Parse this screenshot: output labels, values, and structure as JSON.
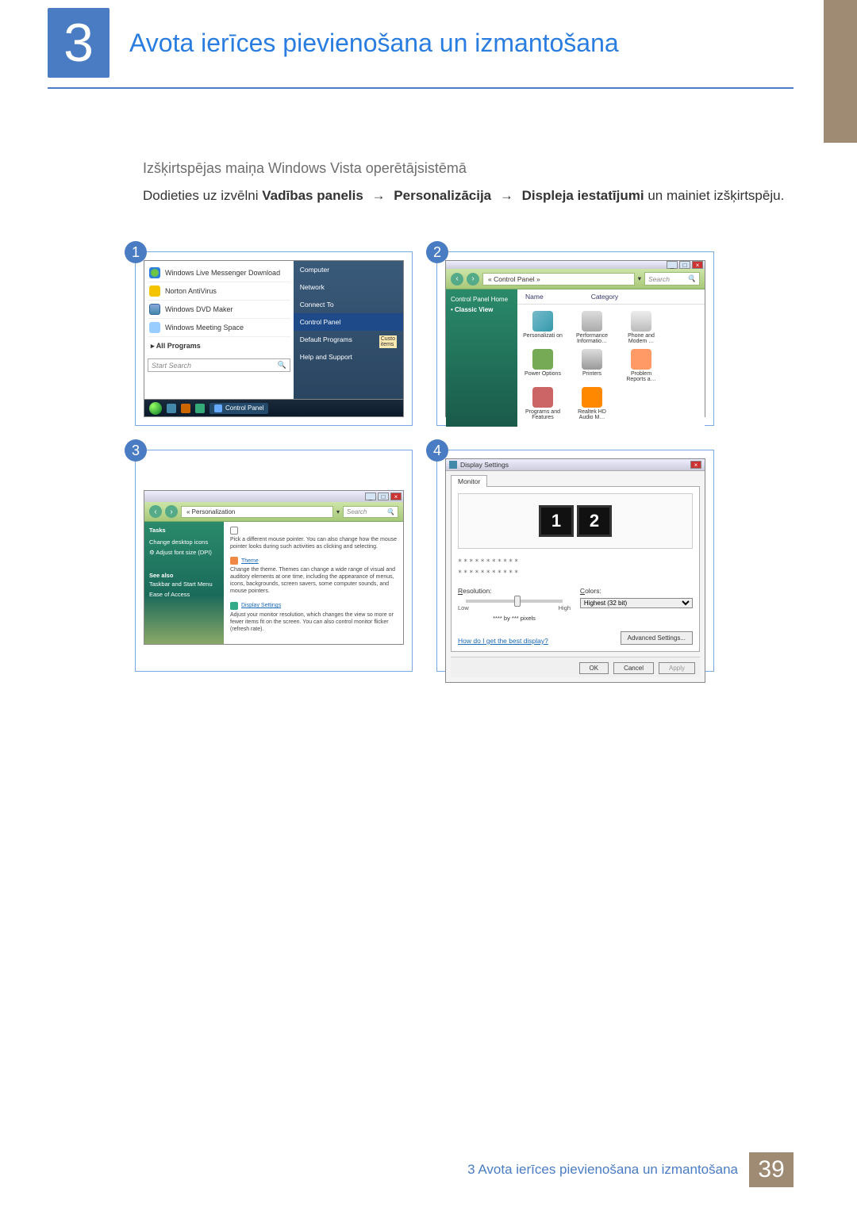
{
  "header": {
    "chapter_number": "3",
    "title": "Avota ierīces pievienošana un izmantošana"
  },
  "section": {
    "sub_heading": "Izšķirtspējas maiņa Windows Vista operētājsistēmā",
    "instr_prefix": "Dodieties uz izvēlni ",
    "instr_b1": "Vadības panelis",
    "instr_b2": "Personalizācija",
    "instr_b3": "Displeja iestatījumi",
    "instr_suffix": " un mainiet izšķirtspēju.",
    "arrow": "→"
  },
  "steps": {
    "s1": "1",
    "s2": "2",
    "s3": "3",
    "s4": "4"
  },
  "panel1": {
    "items": {
      "msn": "Windows Live Messenger Download",
      "norton": "Norton AntiVirus",
      "dvd": "Windows DVD Maker",
      "meeting": "Windows Meeting Space",
      "all": "All Programs"
    },
    "right": {
      "computer": "Computer",
      "network": "Network",
      "connect": "Connect To",
      "cpanel": "Control Panel",
      "defprog": "Default Programs",
      "custo": "Custo",
      "items_small": "items",
      "help": "Help and Support"
    },
    "search_placeholder": "Start Search",
    "taskbar_cp": "Control Panel"
  },
  "panel2": {
    "crumb": "« Control Panel »",
    "search": "Search",
    "side": {
      "home": "Control Panel Home",
      "classic": "Classic View"
    },
    "cols": {
      "name": "Name",
      "category": "Category"
    },
    "icons": {
      "personalization": "Personalizati on",
      "performance": "Performance Informatio…",
      "phone": "Phone and Modem …",
      "power": "Power Options",
      "printers": "Printers",
      "problem": "Problem Reports a…",
      "programs": "Programs and Features",
      "realtek": "Realtek HD Audio M…"
    }
  },
  "panel3": {
    "crumb": "« Personalization",
    "search": "Search",
    "side": {
      "tasks": "Tasks",
      "cdi": "Change desktop icons",
      "afs": "Adjust font size (DPI)",
      "seealso": "See also",
      "tsm": "Taskbar and Start Menu",
      "eoa": "Ease of Access"
    },
    "main": {
      "ptr_head": "Pick a different mouse pointer. You can also change how the mouse pointer looks during such activities as clicking and selecting.",
      "theme_title": "Theme",
      "theme_body": "Change the theme. Themes can change a wide range of visual and auditory elements at one time, including the appearance of menus, icons, backgrounds, screen savers, some computer sounds, and mouse pointers.",
      "ds_title": "Display Settings",
      "ds_body": "Adjust your monitor resolution, which changes the view so more or fewer items fit on the screen. You can also control monitor flicker (refresh rate)."
    }
  },
  "panel4": {
    "title": "Display Settings",
    "tab": "Monitor",
    "mon1": "1",
    "mon2": "2",
    "dots": "***********",
    "res_label": "Resolution:",
    "low": "Low",
    "high": "High",
    "pixels": "**** by *** pixels",
    "colors_label": "Colors:",
    "colors_val": "Highest (32 bit)",
    "best_link": "How do I get the best display?",
    "adv": "Advanced Settings...",
    "ok": "OK",
    "cancel": "Cancel",
    "apply": "Apply"
  },
  "footer": {
    "text": "3 Avota ierīces pievienošana un izmantošana",
    "page": "39"
  }
}
